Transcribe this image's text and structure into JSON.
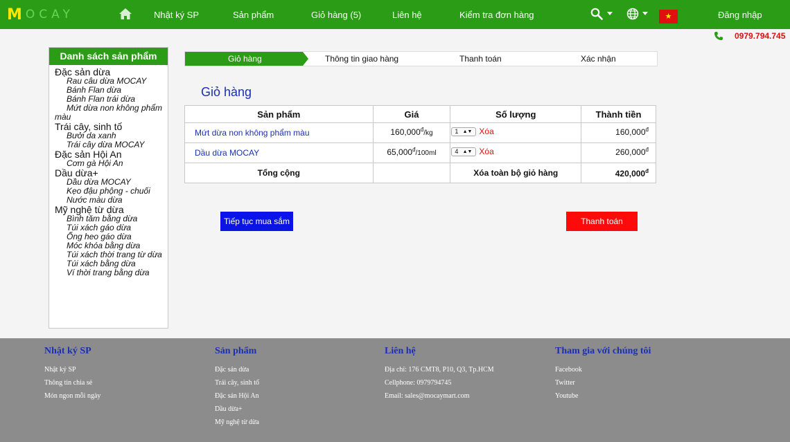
{
  "header": {
    "logo_m": "M",
    "logo_rest": "OCAY",
    "nav": [
      {
        "label": "Nhật ký SP"
      },
      {
        "label": "Sản phẩm"
      },
      {
        "label": "Giỏ hàng (5)"
      },
      {
        "label": "Liên hệ"
      },
      {
        "label": "Kiểm tra đơn hàng"
      }
    ],
    "login": "Đăng nhập",
    "flag_star": "★",
    "phone": "0979.794.745"
  },
  "sidebar": {
    "title": "Danh sách sản phẩm",
    "categories": [
      {
        "label": "Đặc sản dừa",
        "items": [
          "Rau câu dừa MOCAY",
          "Bánh Flan dừa",
          "Bánh Flan trái dừa",
          "Mứt dừa non không phẩm màu"
        ]
      },
      {
        "label": "Trái cây, sinh tố",
        "items": [
          "Bưởi da xanh",
          "Trái cây dừa MOCAY"
        ]
      },
      {
        "label": "Đặc sản Hội An",
        "items": [
          "Cơm gà Hội An"
        ]
      },
      {
        "label": "Dầu dừa+",
        "items": [
          "Dầu dừa MOCAY",
          "Kẹo đậu phộng - chuối",
          "Nước màu dừa"
        ]
      },
      {
        "label": "Mỹ nghệ từ dừa",
        "items": [
          "Bình tăm bằng dừa",
          "Túi xách gáo dừa",
          "Ống heo gáo dừa",
          "Móc khóa bằng dừa",
          "Túi xách thời trang từ dừa",
          "Túi xách bằng dừa",
          "Ví thời trang bằng dừa"
        ]
      }
    ]
  },
  "steps": [
    "Giỏ hàng",
    "Thông tin giao hàng",
    "Thanh toán",
    "Xác nhận"
  ],
  "cart": {
    "title": "Giỏ hàng",
    "columns": [
      "Sản phẩm",
      "Giá",
      "Số lượng",
      "Thành tiền"
    ],
    "rows": [
      {
        "name": "Mứt dừa non không phẩm màu",
        "price": "160,000",
        "unit": "/kg",
        "qty": "1",
        "delete": "Xóa",
        "total": "160,000"
      },
      {
        "name": "Dầu dừa MOCAY",
        "price": "65,000",
        "unit": "/100ml",
        "qty": "4",
        "delete": "Xóa",
        "total": "260,000"
      }
    ],
    "currency": "đ",
    "total_label": "Tổng cộng",
    "clear_all": "Xóa toàn bộ giỏ hàng",
    "grand_total": "420,000"
  },
  "buttons": {
    "continue": "Tiếp tục mua sắm",
    "pay": "Thanh toán"
  },
  "footer": {
    "columns": [
      {
        "heading": "Nhật ký SP",
        "links": [
          "Nhật ký SP",
          "Thông tin chia sẻ",
          "Món ngon mỗi ngày"
        ]
      },
      {
        "heading": "Sản phẩm",
        "links": [
          "Đặc sản dừa",
          "Trái cây, sinh tố",
          "Đặc sản Hội An",
          "Dầu dừa+",
          "Mỹ nghệ từ dừa"
        ]
      },
      {
        "heading": "Liên hệ",
        "links": [
          "Địa chỉ: 176 CMT8, P10, Q3, Tp.HCM",
          "Cellphone: 0979794745",
          "Email: sales@mocaymart.com"
        ]
      },
      {
        "heading": "Tham gia với chúng tôi",
        "links": [
          "Facebook",
          "Twitter",
          "Youtube"
        ]
      }
    ]
  },
  "colors": {
    "brand_green": "#2b9c16",
    "link_blue": "#1a2fb4",
    "alert_red": "#e01010",
    "button_blue": "#0a14e6",
    "footer_gray": "#8c8c8c"
  }
}
